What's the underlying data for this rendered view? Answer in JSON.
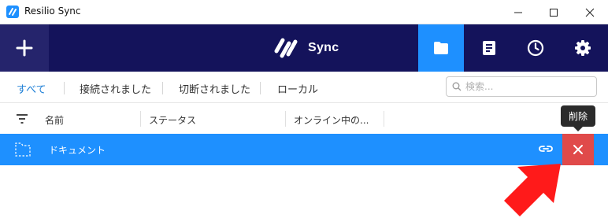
{
  "window": {
    "title": "Resilio Sync",
    "controls": [
      "minimize-icon",
      "maximize-icon",
      "close-icon"
    ]
  },
  "header": {
    "add_icon": "plus-icon",
    "brand": "Sync",
    "nav": [
      {
        "icon": "folder-icon",
        "active": true
      },
      {
        "icon": "log-icon",
        "active": false
      },
      {
        "icon": "clock-icon",
        "active": false
      },
      {
        "icon": "gear-icon",
        "active": false
      }
    ]
  },
  "filters": {
    "tabs": [
      "すべて",
      "接続されました",
      "切断されました",
      "ローカル"
    ],
    "active": "すべて",
    "search_placeholder": "検索..."
  },
  "columns": {
    "name": "名前",
    "status": "ステータス",
    "online": "オンライン中の..."
  },
  "rows": [
    {
      "name": "ドキュメント",
      "selected": true
    }
  ],
  "tooltip": {
    "text": "削除"
  },
  "colors": {
    "header_bg": "#14135b",
    "accent": "#1e90ff",
    "delete": "#e04a4a",
    "annotation": "#ff0000"
  }
}
